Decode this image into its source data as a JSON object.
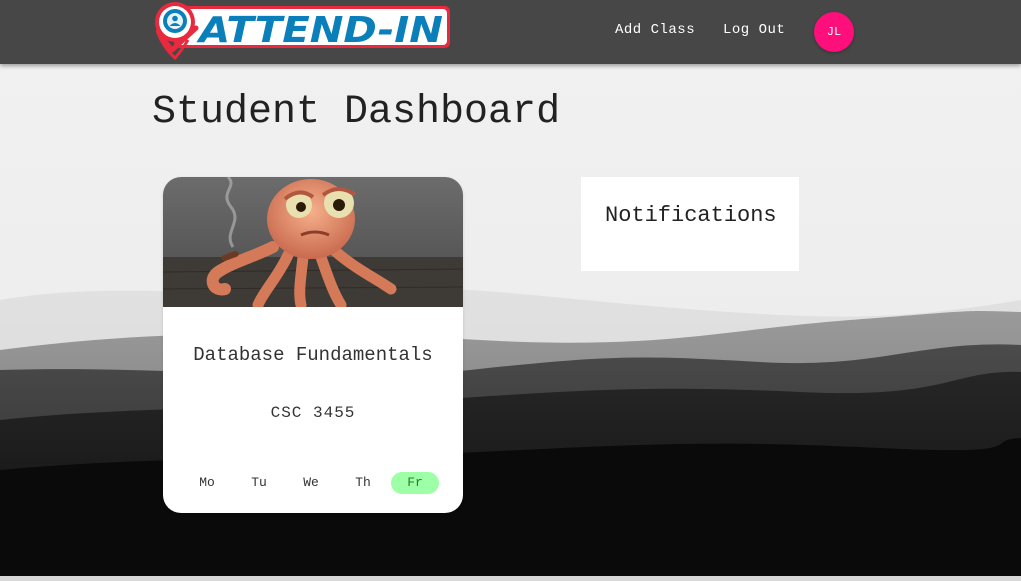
{
  "app": {
    "logo_text": "ATTEND-IN"
  },
  "navbar": {
    "add_class_label": "Add Class",
    "logout_label": "Log Out",
    "avatar_initials": "JL"
  },
  "page": {
    "title": "Student Dashboard"
  },
  "class_card": {
    "image_icon": "octopus-illustration",
    "name": "Database Fundamentals",
    "code": "CSC 3455",
    "days": [
      {
        "label": "Mo",
        "active": false
      },
      {
        "label": "Tu",
        "active": false
      },
      {
        "label": "We",
        "active": false
      },
      {
        "label": "Th",
        "active": false
      },
      {
        "label": "Fr",
        "active": true
      }
    ]
  },
  "notifications": {
    "title": "Notifications"
  },
  "colors": {
    "navbar": "#474747",
    "avatar": "#ff0f7b",
    "logo_blue": "#0a7fb9",
    "logo_red": "#e8293e",
    "active_day": "#9dffa6",
    "background": "#f1f1f1"
  }
}
